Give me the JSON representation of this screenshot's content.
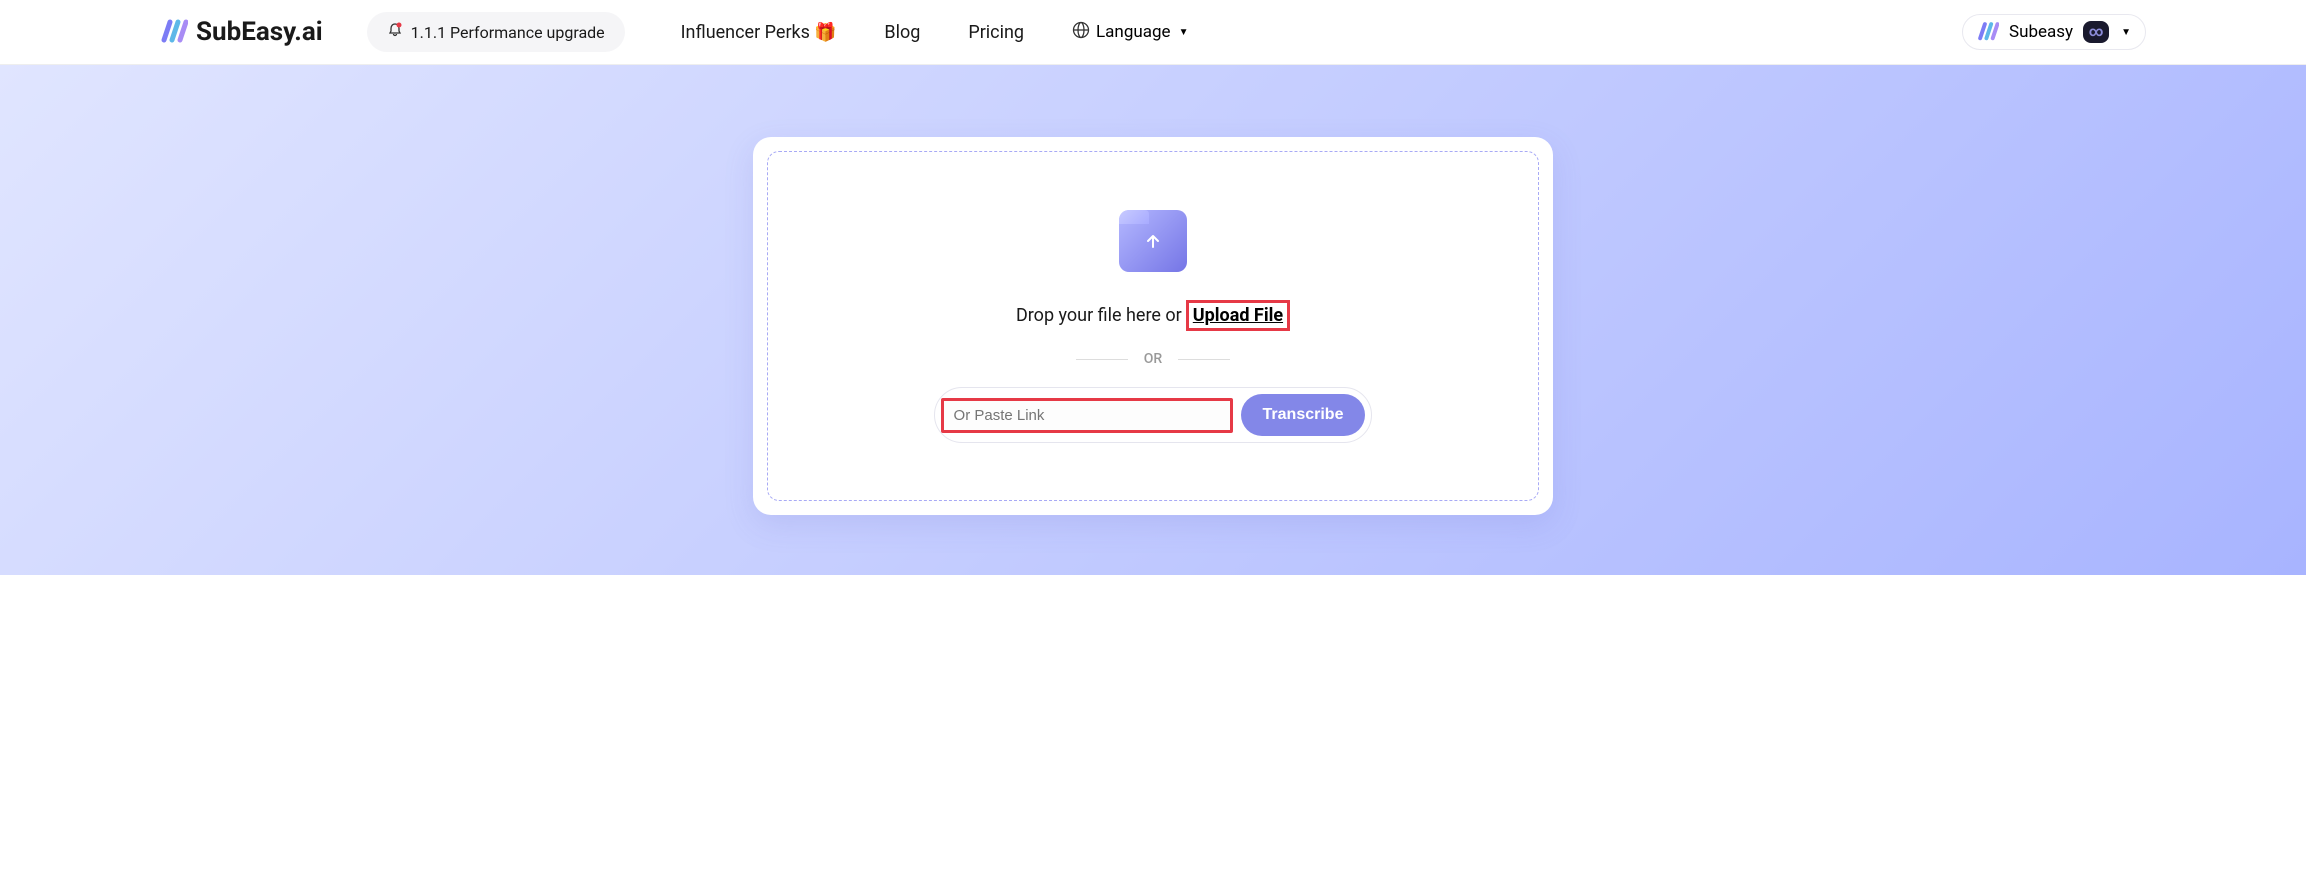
{
  "header": {
    "logo_text": "SubEasy.ai",
    "announcement": "1.1.1 Performance upgrade",
    "nav": {
      "influencer": "Influencer Perks",
      "blog": "Blog",
      "pricing": "Pricing",
      "language": "Language"
    },
    "user_name": "Subeasy",
    "badge": "∞"
  },
  "upload": {
    "drop_text": "Drop your file here or",
    "upload_file": "Upload File",
    "or": "OR",
    "paste_placeholder": "Or Paste Link",
    "transcribe": "Transcribe"
  }
}
